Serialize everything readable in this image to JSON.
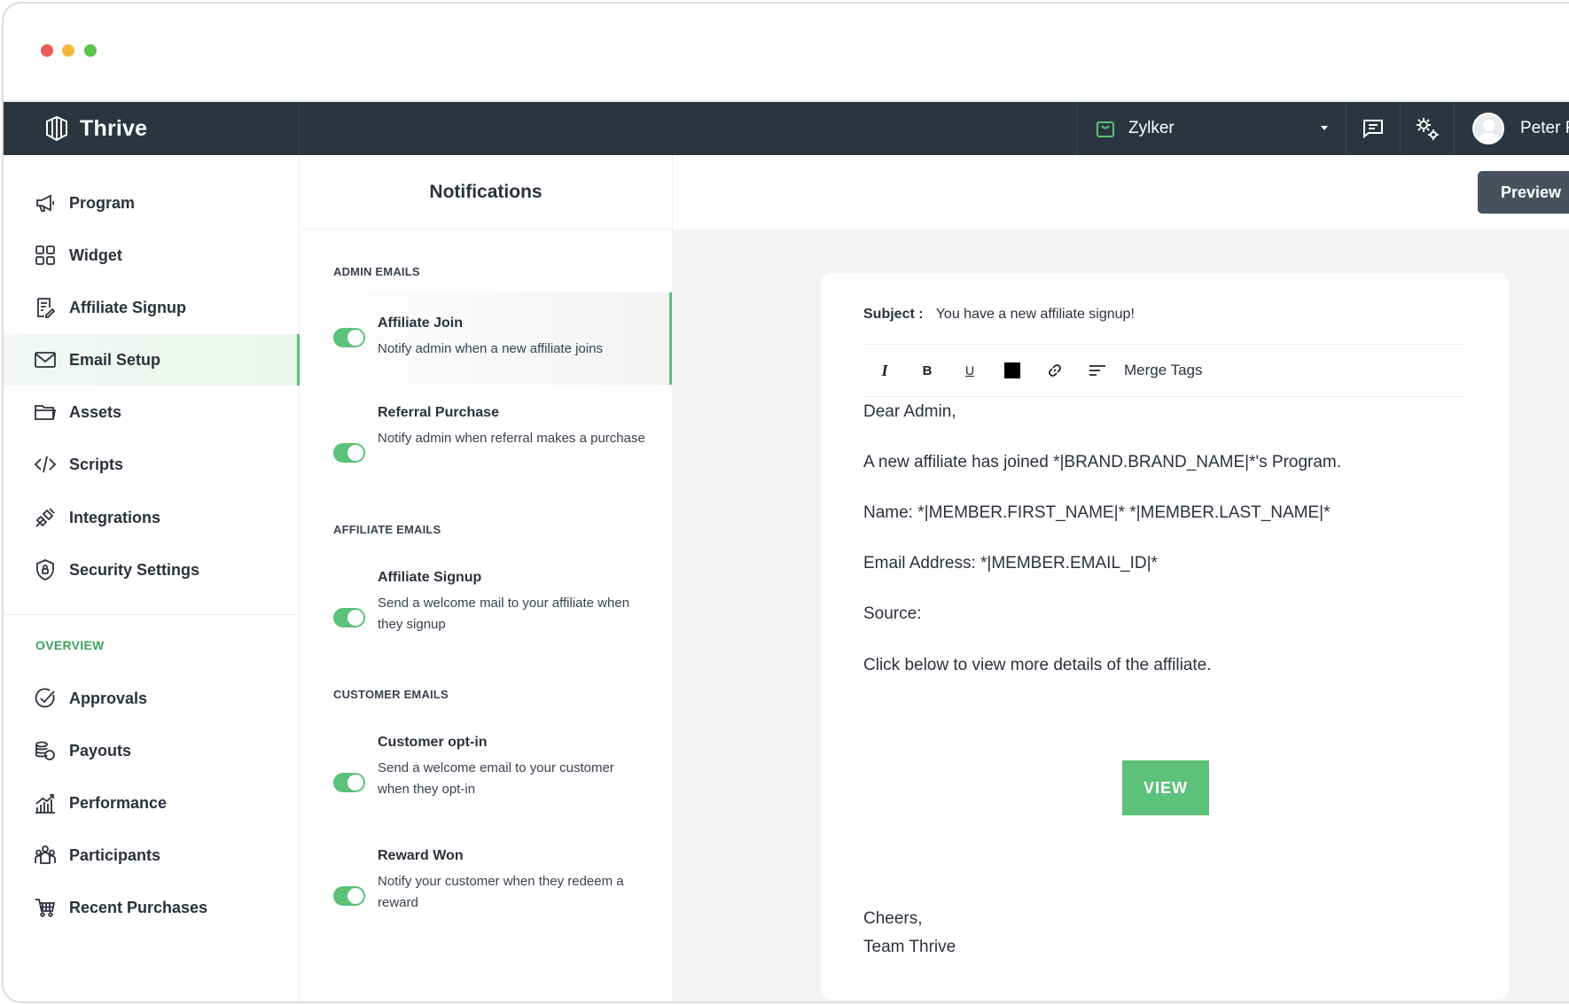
{
  "window": {
    "controls": {
      "close_color": "#ec5b55",
      "min_color": "#f4b73c",
      "max_color": "#5ac44d"
    }
  },
  "topbar": {
    "brand": "Thrive",
    "store": "Zylker",
    "user": "Peter F"
  },
  "sidebar": {
    "items": [
      {
        "label": "Program",
        "icon": "megaphone-icon"
      },
      {
        "label": "Widget",
        "icon": "grid-icon"
      },
      {
        "label": "Affiliate Signup",
        "icon": "form-icon"
      },
      {
        "label": "Email Setup",
        "icon": "mail-icon",
        "active": true
      },
      {
        "label": "Assets",
        "icon": "folder-icon"
      },
      {
        "label": "Scripts",
        "icon": "code-icon"
      },
      {
        "label": "Integrations",
        "icon": "plug-icon"
      },
      {
        "label": "Security Settings",
        "icon": "shield-icon"
      }
    ],
    "overview_label": "OVERVIEW",
    "overview_items": [
      {
        "label": "Approvals",
        "icon": "check-circle-icon"
      },
      {
        "label": "Payouts",
        "icon": "coins-icon"
      },
      {
        "label": "Performance",
        "icon": "bar-chart-icon"
      },
      {
        "label": "Participants",
        "icon": "people-icon"
      },
      {
        "label": "Recent Purchases",
        "icon": "cart-icon"
      }
    ]
  },
  "notifications": {
    "title": "Notifications",
    "sections": {
      "admin": "ADMIN EMAILS",
      "affiliate": "AFFILIATE EMAILS",
      "customer": "CUSTOMER EMAILS"
    },
    "items": [
      {
        "title": "Affiliate Join",
        "desc": "Notify admin when a new affiliate joins",
        "enabled": true
      },
      {
        "title": "Referral Purchase",
        "desc": "Notify admin when referral makes a purchase",
        "enabled": true
      },
      {
        "title": "Affiliate Signup",
        "desc": "Send a welcome mail to your affiliate when they signup",
        "enabled": true
      },
      {
        "title": "Customer opt-in",
        "desc": "Send a welcome email to your customer when they opt-in",
        "enabled": true
      },
      {
        "title": "Reward Won",
        "desc": "Notify your customer when they redeem a reward",
        "enabled": true
      }
    ]
  },
  "editor": {
    "preview_label": "Preview",
    "subject_label": "Subject :",
    "subject_value": "You have a new affiliate signup!",
    "toolbar": {
      "italic": "I",
      "bold": "B",
      "underline": "U",
      "merge_tags": "Merge Tags"
    },
    "body": {
      "greeting": "Dear Admin,",
      "line1": "A new affiliate has joined *|BRAND.BRAND_NAME|*'s Program.",
      "line2": "Name: *|MEMBER.FIRST_NAME|* *|MEMBER.LAST_NAME|*",
      "line3": "Email Address: *|MEMBER.EMAIL_ID|*",
      "line4": "Source:",
      "line5": "Click below to view more details of the affiliate.",
      "view_button": "VIEW",
      "signoff1": "Cheers,",
      "signoff2": "Team Thrive"
    }
  },
  "colors": {
    "accent": "#5cc17a",
    "topbar": "#2b353f",
    "preview_button": "#46515c"
  }
}
